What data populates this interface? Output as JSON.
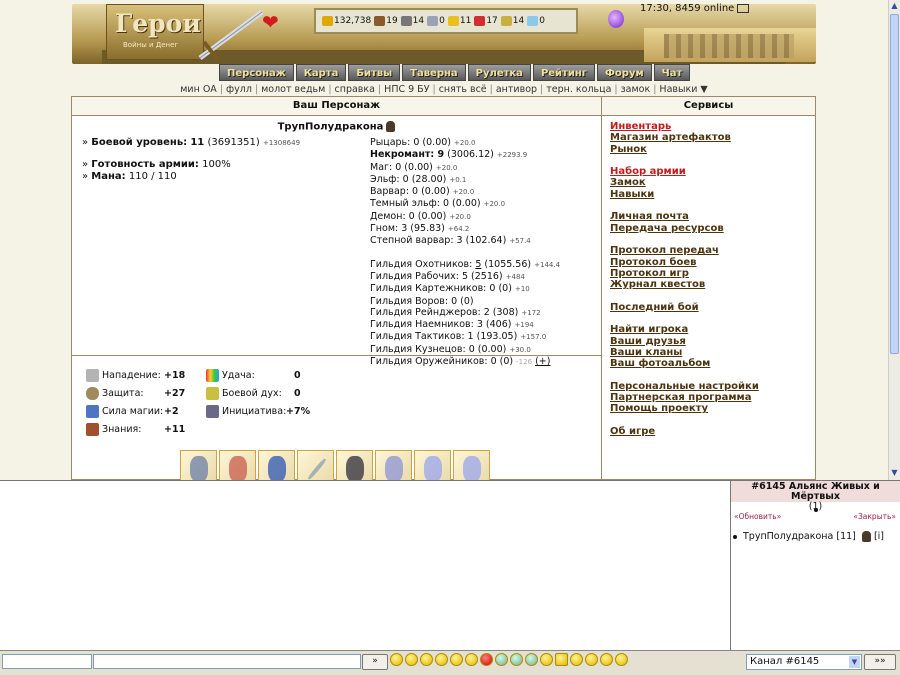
{
  "header": {
    "logo_title": "Герои",
    "logo_subtitle": "Войны и Денег",
    "status_time": "17:30, 8459 online",
    "resources": [
      {
        "icon": "gold-icon",
        "value": "132,738",
        "color": "#e0a800"
      },
      {
        "icon": "wood-icon",
        "value": "19",
        "color": "#8a5a2b"
      },
      {
        "icon": "ore-icon",
        "value": "14",
        "color": "#777777"
      },
      {
        "icon": "mercury-icon",
        "value": "0",
        "color": "#9aa3b5"
      },
      {
        "icon": "sulfur-icon",
        "value": "11",
        "color": "#e8c020"
      },
      {
        "icon": "crystal-icon",
        "value": "17",
        "color": "#d03030"
      },
      {
        "icon": "gems-icon",
        "value": "14",
        "color": "#c8b040"
      },
      {
        "icon": "diamond-icon",
        "value": "0",
        "color": "#8cc8e8"
      }
    ]
  },
  "nav": [
    "Персонаж",
    "Карта",
    "Битвы",
    "Таверна",
    "Рулетка",
    "Рейтинг",
    "Форум",
    "Чат"
  ],
  "subnav": [
    "мин ОА",
    "фулл",
    "молот ведьм",
    "справка",
    "НПС 9 БУ",
    "снять всё",
    "антивор",
    "терн. кольца",
    "замок",
    "Навыки ▼"
  ],
  "character": {
    "panel_title": "Ваш Персонаж",
    "name": "ТрупПолудракона",
    "combat_level_label": "Боевой уровень:",
    "combat_level": "11",
    "combat_exp": "(3691351)",
    "combat_exp_delta": "+1308649",
    "army_label": "Готовность армии:",
    "army_value": "100%",
    "mana_label": "Мана:",
    "mana_value": "110 / 110"
  },
  "factions": [
    {
      "label": "Рыцарь: 0 (0.00)",
      "delta": "+20.0"
    },
    {
      "label": "Некромант: 9",
      "extra": "(3006.12)",
      "delta": "+2293.9"
    },
    {
      "label": "Маг: 0 (0.00)",
      "delta": "+20.0"
    },
    {
      "label": "Эльф: 0 (28.00)",
      "delta": "+0.1"
    },
    {
      "label": "Варвар: 0 (0.00)",
      "delta": "+20.0"
    },
    {
      "label": "Темный эльф: 0 (0.00)",
      "delta": "+20.0"
    },
    {
      "label": "Демон: 0 (0.00)",
      "delta": "+20.0"
    },
    {
      "label": "Гном: 3 (95.83)",
      "delta": "+64.2"
    },
    {
      "label": "Степной варвар: 3 (102.64)",
      "delta": "+57.4"
    }
  ],
  "guilds": [
    {
      "pre": "Гильдия Охотников: ",
      "link": "5",
      "post": " (1055.56)",
      "delta": "+144.4"
    },
    {
      "pre": "Гильдия Рабочих: 5 (2516)",
      "delta": "+484"
    },
    {
      "pre": "Гильдия Картежников: 0 (0)",
      "delta": "+10"
    },
    {
      "pre": "Гильдия Воров: 0 (0)",
      "delta": ""
    },
    {
      "pre": "Гильдия Рейнджеров: 2 (308)",
      "delta": "+172"
    },
    {
      "pre": "Гильдия Наемников: 3 (406)",
      "delta": "+194"
    },
    {
      "pre": "Гильдия Тактиков: 1 (193.05)",
      "delta": "+157.0"
    },
    {
      "pre": "Гильдия Кузнецов: 0 (0.00)",
      "delta": "+30.0"
    },
    {
      "pre": "Гильдия Оружейников: 0 (0)",
      "delta": "-126",
      "action": "(+)"
    }
  ],
  "battle_stats": {
    "attack": {
      "label": "Нападение:",
      "value": "+18"
    },
    "defense": {
      "label": "Защита:",
      "value": "+27"
    },
    "spellpower": {
      "label": "Сила магии:",
      "value": "+2"
    },
    "knowledge": {
      "label": "Знания:",
      "value": "+11"
    },
    "luck": {
      "label": "Удача:",
      "value": "0"
    },
    "morale": {
      "label": "Боевой дух:",
      "value": "0"
    },
    "initiative": {
      "label": "Инициатива:",
      "value": "+7%"
    }
  },
  "services": {
    "title": "Сервисы",
    "groups": [
      [
        {
          "label": "Инвентарь",
          "red": true
        },
        {
          "label": "Магазин артефактов"
        },
        {
          "label": "Рынок"
        }
      ],
      [
        {
          "label": "Набор армии",
          "red": true
        },
        {
          "label": "Замок"
        },
        {
          "label": "Навыки"
        }
      ],
      [
        {
          "label": "Личная почта"
        },
        {
          "label": "Передача ресурсов"
        }
      ],
      [
        {
          "label": "Протокол передач"
        },
        {
          "label": "Протокол боев"
        },
        {
          "label": "Протокол игр"
        },
        {
          "label": "Журнал квестов"
        }
      ],
      [
        {
          "label": "Последний бой"
        }
      ],
      [
        {
          "label": "Найти игрока"
        },
        {
          "label": "Ваши друзья"
        },
        {
          "label": "Ваши кланы"
        },
        {
          "label": "Ваш фотоальбом"
        }
      ],
      [
        {
          "label": "Персональные настройки"
        },
        {
          "label": "Партнерская программа"
        },
        {
          "label": "Помощь проекту"
        }
      ],
      [
        {
          "label": "Об игре"
        }
      ]
    ]
  },
  "chat": {
    "room_title": "#6145 Альянс Живых и Мёртвых",
    "room_count": "(1)",
    "refresh_link": "«Обновить»",
    "close_link": "«Закрыть»",
    "user_name": "ТрупПолудракона",
    "user_level": "[11]",
    "user_tag": "[i]",
    "send_label": "»",
    "channel": "Канал #6145",
    "channel_send": "»»"
  }
}
